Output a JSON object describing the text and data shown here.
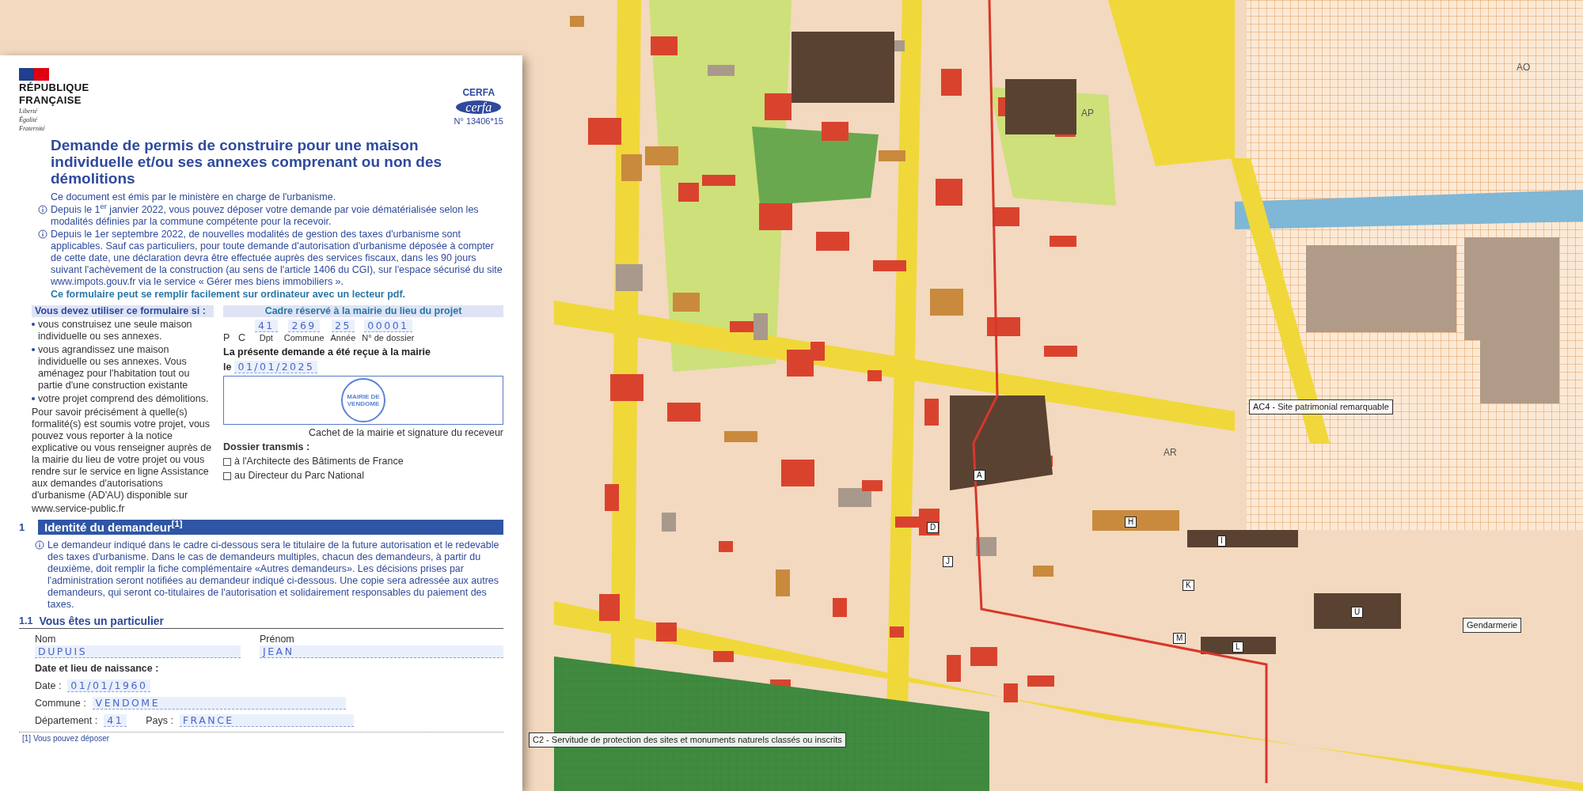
{
  "map": {
    "labels": [
      {
        "kind": "callout",
        "text": "AC4 - Site patrimonial remarquable"
      },
      {
        "kind": "callout",
        "text": "Gendarmerie"
      },
      {
        "kind": "callout",
        "text": "C2 - Servitude de protection des sites et monuments naturels classés ou inscrits"
      },
      {
        "kind": "zone",
        "text": "AP"
      },
      {
        "kind": "zone",
        "text": "AO"
      },
      {
        "kind": "zone",
        "text": "AR"
      },
      {
        "kind": "box",
        "text": "A"
      },
      {
        "kind": "box",
        "text": "D"
      },
      {
        "kind": "box",
        "text": "J"
      },
      {
        "kind": "box",
        "text": "H"
      },
      {
        "kind": "box",
        "text": "I"
      },
      {
        "kind": "box",
        "text": "K"
      },
      {
        "kind": "box",
        "text": "M"
      },
      {
        "kind": "box",
        "text": "L"
      },
      {
        "kind": "box",
        "text": "U"
      }
    ]
  },
  "document": {
    "brand": {
      "lines": [
        "RÉPUBLIQUE",
        "FRANÇAISE"
      ],
      "motto": [
        "Liberté",
        "Égalité",
        "Fraternité"
      ]
    },
    "cerfa": {
      "label": "CERFA",
      "logo": "cerfa",
      "number": "N° 13406*15"
    },
    "title": "Demande de permis de construire pour une maison individuelle et/ou ses annexes comprenant ou non des démolitions",
    "intro": [
      {
        "kind": "plain",
        "text": "Ce document est émis par le ministère en charge de l'urbanisme."
      },
      {
        "kind": "info",
        "text": "Depuis le 1$^{er}$ janvier 2022, vous pouvez déposer votre demande par voie dématérialisée selon les modalités définies par la commune compétente pour la recevoir."
      },
      {
        "kind": "info",
        "text": "Depuis le 1er septembre 2022, de nouvelles modalités de gestion des taxes d'urbanisme sont applicables. Sauf cas particuliers, pour toute demande d'autorisation d'urbanisme déposée à compter de cette date, une déclaration devra être effectuée auprès des services fiscaux, dans les 90 jours suivant l'achèvement de la construction (au sens de l'article 1406 du CGI), sur l'espace sécurisé du site www.impots.gouv.fr via le service « Gérer mes biens immobiliers »."
      },
      {
        "kind": "note",
        "text": "Ce formulaire peut se remplir facilement sur ordinateur avec un lecteur pdf."
      }
    ],
    "usage": {
      "heading": "Vous devez utiliser ce formulaire si :",
      "bullets": [
        "vous construisez une seule maison individuelle ou ses annexes.",
        "vous agrandissez une maison individuelle ou ses annexes. Vous aménagez pour l'habitation tout ou partie d'une construction existante",
        "votre projet comprend des démolitions."
      ],
      "paragraph": "Pour savoir précisément à quelle(s) formalité(s) est soumis votre projet, vous pouvez vous reporter à la notice explicative ou vous renseigner auprès de la mairie du lieu de votre projet ou vous rendre sur le service en ligne Assistance aux demandes d'autorisations d'urbanisme (AD'AU) disponible sur",
      "link": "www.service-public.fr"
    },
    "reserved": {
      "heading": "Cadre réservé à la mairie du lieu du projet",
      "prefix": "P C",
      "parts": [
        {
          "label": "Dpt",
          "value": "41"
        },
        {
          "label": "Commune",
          "value": "269"
        },
        {
          "label": "Année",
          "value": "25"
        },
        {
          "label": "N° de dossier",
          "value": "00001"
        }
      ],
      "received": "La présente demande a été reçue à la mairie",
      "date_prefix": "le",
      "date": "01/01/2025",
      "stamp": "MAIRIE DE VENDOME",
      "caption": "Cachet de la mairie et signature du receveur",
      "transmitted": "Dossier transmis :",
      "checks": [
        {
          "label": "à l'Architecte des Bâtiments de France",
          "checked": false
        },
        {
          "label": "au Directeur du Parc National",
          "checked": false
        }
      ]
    },
    "section": {
      "number": "1",
      "title": "Identité du demandeur$^{[1]}$",
      "text": "Le demandeur indiqué dans le cadre ci-dessous sera le titulaire de la future autorisation et le redevable des taxes d'urbanisme. Dans le cas de demandeurs multiples, chacun des demandeurs, à partir du deuxième, doit remplir la fiche complémentaire «Autres demandeurs». Les décisions prises par l'administration seront notifiées au demandeur indiqué ci-dessous. Une copie sera adressée aux autres demandeurs, qui seront co-titulaires de l'autorisation et solidairement responsables du paiement des taxes."
    },
    "person": {
      "number": "1.1",
      "title": "Vous êtes un particulier",
      "nom_label": "Nom",
      "nom": "DUPUIS",
      "prenom_label": "Prénom",
      "prenom": "JEAN",
      "birth_heading": "Date et lieu de naissance :",
      "date_label": "Date :",
      "date": "01/01/1960",
      "commune_label": "Commune :",
      "commune": "VENDOME",
      "dept_label": "Département :",
      "dept": "41",
      "pays_label": "Pays :",
      "pays": "FRANCE"
    },
    "footnote": "[1] Vous pouvez déposer"
  }
}
